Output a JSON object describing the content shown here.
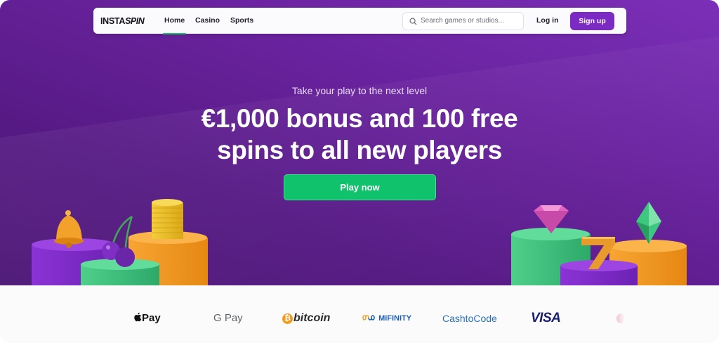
{
  "brand": {
    "logo_text": "INSTA",
    "logo_text_2": "SPIN"
  },
  "nav": {
    "links": [
      {
        "label": "Home",
        "active": true
      },
      {
        "label": "Casino",
        "active": false
      },
      {
        "label": "Sports",
        "active": false
      }
    ],
    "search": {
      "placeholder": "Search games or studios..."
    },
    "login_label": "Log in",
    "signup_label": "Sign up"
  },
  "hero": {
    "kicker": "Take your play to the next level",
    "headline_line1": "€1,000 bonus and 100 free",
    "headline_line2": "spins to all new players",
    "cta_label": "Play now"
  },
  "payments": {
    "methods": [
      "Pay",
      "G Pay",
      "bitcoin",
      "MiFINITY",
      "CashtoCode",
      "VISA"
    ]
  },
  "colors": {
    "hero_purple": "#6a239f",
    "accent_green": "#10c26c",
    "signup_purple": "#7b2bc4",
    "active_underline": "#1fbf6a"
  }
}
